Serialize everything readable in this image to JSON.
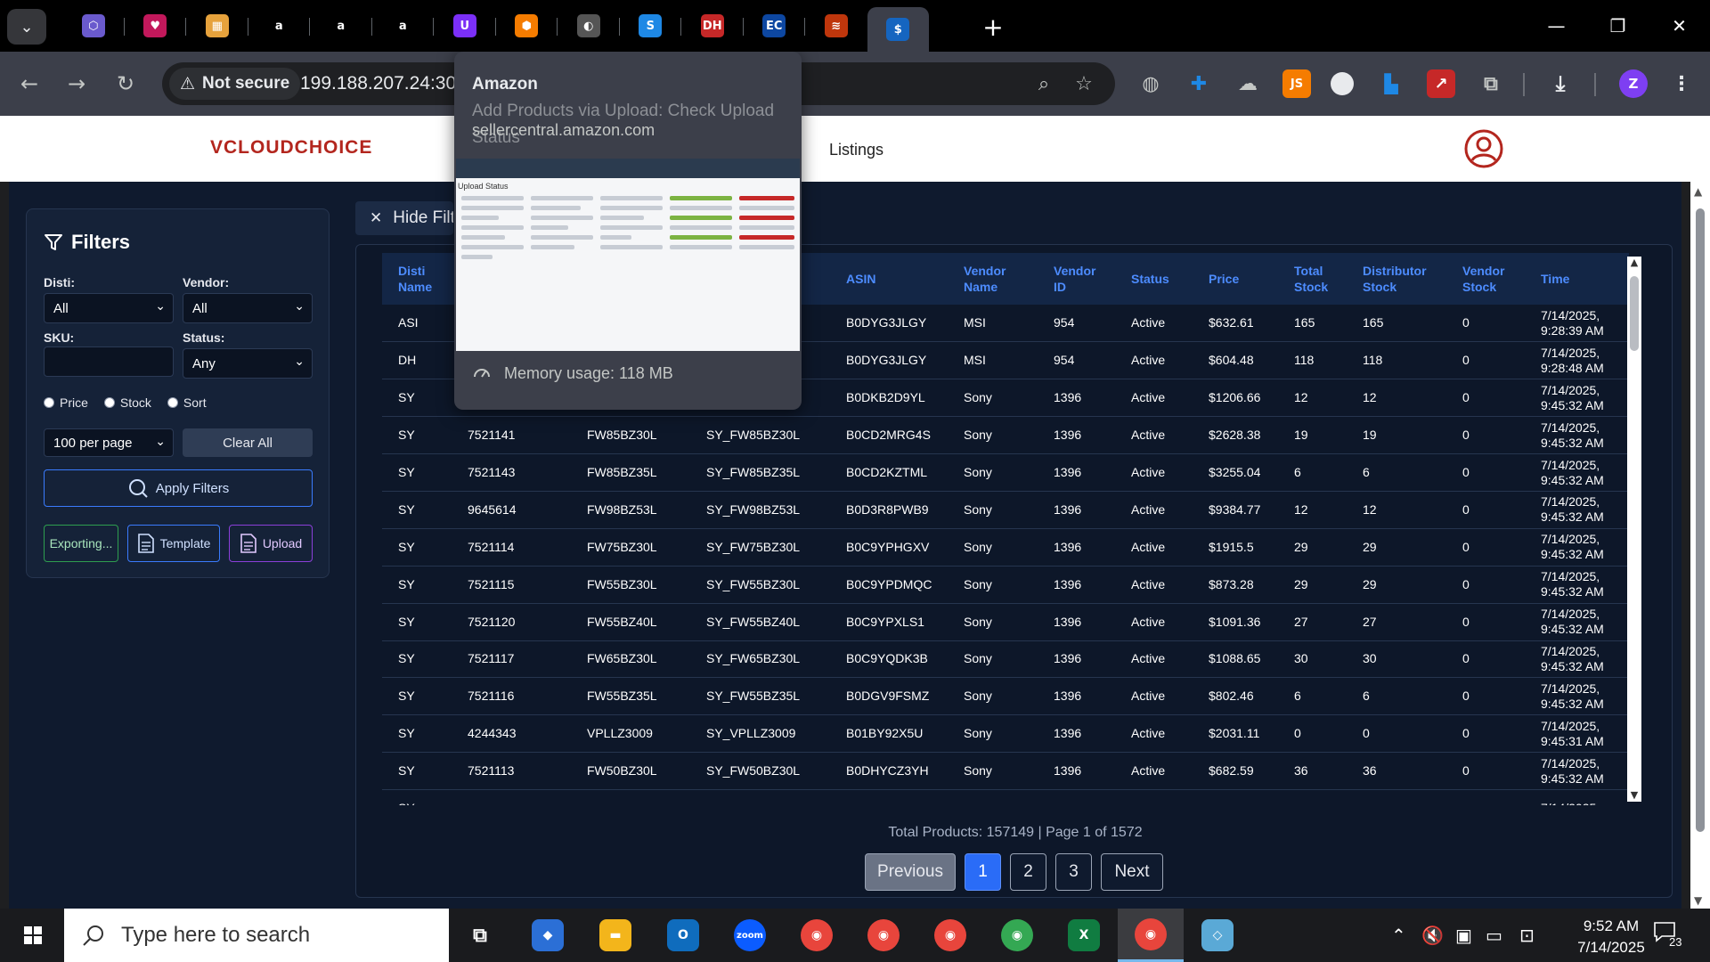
{
  "browser": {
    "tab_search_icon": "chevron-down-icon",
    "tabs": [
      {
        "icon": "cube-icon",
        "color": "#6a5acd",
        "glyph": "⬡"
      },
      {
        "icon": "heart-app-icon",
        "color": "#c2185b",
        "glyph": "♥"
      },
      {
        "icon": "box-icon",
        "color": "#e6a23c",
        "glyph": "▦"
      },
      {
        "icon": "amazon-icon",
        "color": "#000000",
        "glyph": "a"
      },
      {
        "icon": "amazon-icon",
        "color": "#000000",
        "glyph": "a"
      },
      {
        "icon": "amazon-icon",
        "color": "#000000",
        "glyph": "a"
      },
      {
        "icon": "u-app-icon",
        "color": "#7b2ff7",
        "glyph": "U"
      },
      {
        "icon": "hexagon-icon",
        "color": "#f57c00",
        "glyph": "⬢"
      },
      {
        "icon": "globe-icon",
        "color": "#555555",
        "glyph": "◐"
      },
      {
        "icon": "s-logo-icon",
        "color": "#1e88e5",
        "glyph": "S"
      },
      {
        "icon": "dh-logo-icon",
        "color": "#c62828",
        "glyph": "DH"
      },
      {
        "icon": "ec-logo-icon",
        "color": "#0d47a1",
        "glyph": "EC"
      },
      {
        "icon": "stack-icon",
        "color": "#bf360c",
        "glyph": "≋"
      },
      {
        "icon": "dollar-icon",
        "color": "#1565c0",
        "glyph": "$"
      }
    ],
    "new_tab_icon": "plus-icon",
    "address": {
      "security_label": "Not secure",
      "url": "199.188.207.24:300"
    }
  },
  "hovercard": {
    "site": "Amazon",
    "page_title": "Add Products via Upload: Check Upload Status",
    "domain": "sellercentral.amazon.com",
    "thumb_text": "Upload Status",
    "memory": "Memory usage: 118 MB"
  },
  "app": {
    "logo": "VCLOUDCHOICE",
    "nav": {
      "listings": "Listings"
    },
    "filters": {
      "title": "Filters",
      "disti_label": "Disti:",
      "disti_value": "All",
      "vendor_label": "Vendor:",
      "vendor_value": "All",
      "sku_label": "SKU:",
      "sku_value": "",
      "status_label": "Status:",
      "status_value": "Any",
      "radios": [
        "Price",
        "Stock",
        "Sort"
      ],
      "per_page": "100 per page",
      "clear_all": "Clear All",
      "apply": "Apply Filters",
      "exporting": "Exporting...",
      "template": "Template",
      "upload": "Upload"
    },
    "hide_filters": "Hide Filters",
    "table": {
      "columns": [
        "Disti Name",
        "",
        "",
        "",
        "ASIN",
        "Vendor Name",
        "Vendor ID",
        "Status",
        "Price",
        "Total Stock",
        "Distributor Stock",
        "Vendor Stock",
        "Time"
      ],
      "rows": [
        [
          "ASI",
          "",
          "",
          "",
          "B0DYG3JLGY",
          "MSI",
          "954",
          "Active",
          "$632.61",
          "165",
          "165",
          "0",
          "7/14/2025, 9:28:39 AM"
        ],
        [
          "DH",
          "",
          "",
          "",
          "B0DYG3JLGY",
          "MSI",
          "954",
          "Active",
          "$604.48",
          "118",
          "118",
          "0",
          "7/14/2025, 9:28:48 AM"
        ],
        [
          "SY",
          "",
          "",
          "",
          "B0DKB2D9YL",
          "Sony",
          "1396",
          "Active",
          "$1206.66",
          "12",
          "12",
          "0",
          "7/14/2025, 9:45:32 AM"
        ],
        [
          "SY",
          "7521141",
          "FW85BZ30L",
          "SY_FW85BZ30L",
          "B0CD2MRG4S",
          "Sony",
          "1396",
          "Active",
          "$2628.38",
          "19",
          "19",
          "0",
          "7/14/2025, 9:45:32 AM"
        ],
        [
          "SY",
          "7521143",
          "FW85BZ35L",
          "SY_FW85BZ35L",
          "B0CD2KZTML",
          "Sony",
          "1396",
          "Active",
          "$3255.04",
          "6",
          "6",
          "0",
          "7/14/2025, 9:45:32 AM"
        ],
        [
          "SY",
          "9645614",
          "FW98BZ53L",
          "SY_FW98BZ53L",
          "B0D3R8PWB9",
          "Sony",
          "1396",
          "Active",
          "$9384.77",
          "12",
          "12",
          "0",
          "7/14/2025, 9:45:32 AM"
        ],
        [
          "SY",
          "7521114",
          "FW75BZ30L",
          "SY_FW75BZ30L",
          "B0C9YPHGXV",
          "Sony",
          "1396",
          "Active",
          "$1915.5",
          "29",
          "29",
          "0",
          "7/14/2025, 9:45:32 AM"
        ],
        [
          "SY",
          "7521115",
          "FW55BZ30L",
          "SY_FW55BZ30L",
          "B0C9YPDMQC",
          "Sony",
          "1396",
          "Active",
          "$873.28",
          "29",
          "29",
          "0",
          "7/14/2025, 9:45:32 AM"
        ],
        [
          "SY",
          "7521120",
          "FW55BZ40L",
          "SY_FW55BZ40L",
          "B0C9YPXLS1",
          "Sony",
          "1396",
          "Active",
          "$1091.36",
          "27",
          "27",
          "0",
          "7/14/2025, 9:45:32 AM"
        ],
        [
          "SY",
          "7521117",
          "FW65BZ30L",
          "SY_FW65BZ30L",
          "B0C9YQDK3B",
          "Sony",
          "1396",
          "Active",
          "$1088.65",
          "30",
          "30",
          "0",
          "7/14/2025, 9:45:32 AM"
        ],
        [
          "SY",
          "7521116",
          "FW55BZ35L",
          "SY_FW55BZ35L",
          "B0DGV9FSMZ",
          "Sony",
          "1396",
          "Active",
          "$802.46",
          "6",
          "6",
          "0",
          "7/14/2025, 9:45:32 AM"
        ],
        [
          "SY",
          "4244343",
          "VPLLZ3009",
          "SY_VPLLZ3009",
          "B01BY92X5U",
          "Sony",
          "1396",
          "Active",
          "$2031.11",
          "0",
          "0",
          "0",
          "7/14/2025, 9:45:31 AM"
        ],
        [
          "SY",
          "7521113",
          "FW50BZ30L",
          "SY_FW50BZ30L",
          "B0DHYCZ3YH",
          "Sony",
          "1396",
          "Active",
          "$682.59",
          "36",
          "36",
          "0",
          "7/14/2025, 9:45:32 AM"
        ],
        [
          "SY",
          "",
          "",
          "",
          "",
          "",
          "",
          "",
          "",
          "",
          "",
          "",
          "7/14/2025,"
        ]
      ]
    },
    "pagination": {
      "info": "Total Products: 157149 | Page 1 of 1572",
      "previous": "Previous",
      "pages": [
        "1",
        "2",
        "3"
      ],
      "next": "Next"
    }
  },
  "taskbar": {
    "search_placeholder": "Type here to search",
    "time": "9:52 AM",
    "date": "7/14/2025",
    "notification_count": "23"
  },
  "colors": {
    "accent": "#2a6cf7",
    "header_text": "#4d8cff",
    "panel_bg": "#0f1a2e"
  }
}
